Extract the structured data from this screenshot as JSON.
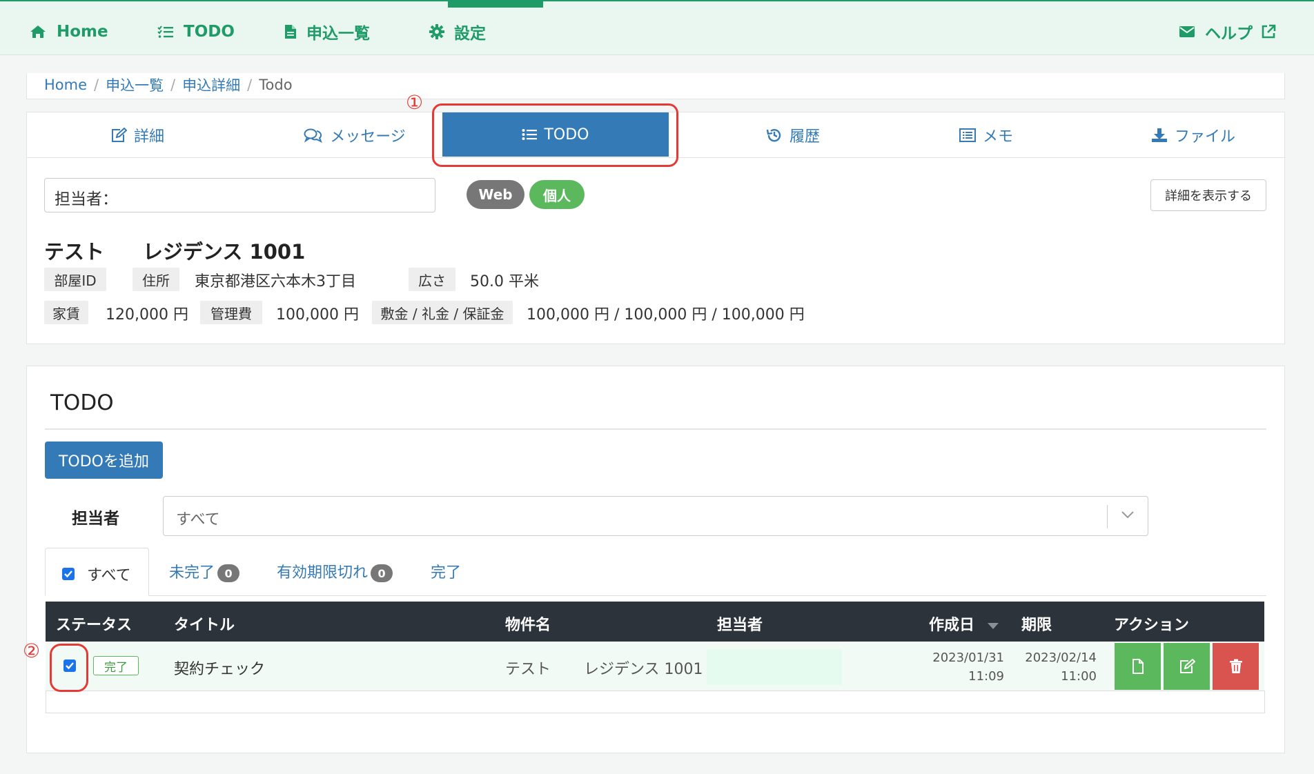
{
  "nav": {
    "home": "Home",
    "todo": "TODO",
    "applications": "申込一覧",
    "settings": "設定",
    "help": "ヘルプ"
  },
  "breadcrumb": [
    "Home",
    "申込一覧",
    "申込詳細",
    "Todo"
  ],
  "tabs": {
    "detail": "詳細",
    "message": "メッセージ",
    "todo": "TODO",
    "history": "履歴",
    "memo": "メモ",
    "file": "ファイル"
  },
  "annotations": {
    "one": "①",
    "two": "②",
    "color": "#e53935"
  },
  "applicant": {
    "assignee_field": "担当者：",
    "badge_web": "Web",
    "badge_personal": "個人",
    "show_detail_button": "詳細を表示する",
    "name": "テスト",
    "property": "レジデンス 1001",
    "room_id_label": "部屋ID",
    "address_label": "住所",
    "address": "東京都港区六本木3丁目",
    "area_label": "広さ",
    "area": "50.0 平米",
    "rent_label": "家賃",
    "rent": "120,000 円",
    "mgmt_fee_label": "管理費",
    "mgmt_fee": "100,000 円",
    "deposit_label": "敷金 / 礼金 / 保証金",
    "deposit": "100,000 円 / 100,000 円 / 100,000 円"
  },
  "todo": {
    "heading": "TODO",
    "add_button": "TODOを追加",
    "filter_label": "担当者",
    "filter_value": "すべて",
    "filter_tabs": {
      "all": "すべて",
      "incomplete": "未完了",
      "incomplete_count": "0",
      "expired": "有効期限切れ",
      "expired_count": "0",
      "done": "完了"
    },
    "columns": [
      "ステータス",
      "タイトル",
      "物件名",
      "担当者",
      "作成日",
      "期限",
      "アクション"
    ],
    "rows": [
      {
        "status": "完了",
        "title": "契約チェック",
        "property_name": "テスト",
        "property_room": "レジデンス 1001",
        "assignee": "",
        "created_date": "2023/01/31",
        "created_time": "11:09",
        "due_date": "2023/02/14",
        "due_time": "11:00",
        "checked": true
      }
    ]
  },
  "colors": {
    "brand_green": "#1e9b67",
    "primary_blue": "#337ab7",
    "success": "#5cb85c",
    "danger": "#d9534f",
    "table_header": "#2d333a"
  }
}
